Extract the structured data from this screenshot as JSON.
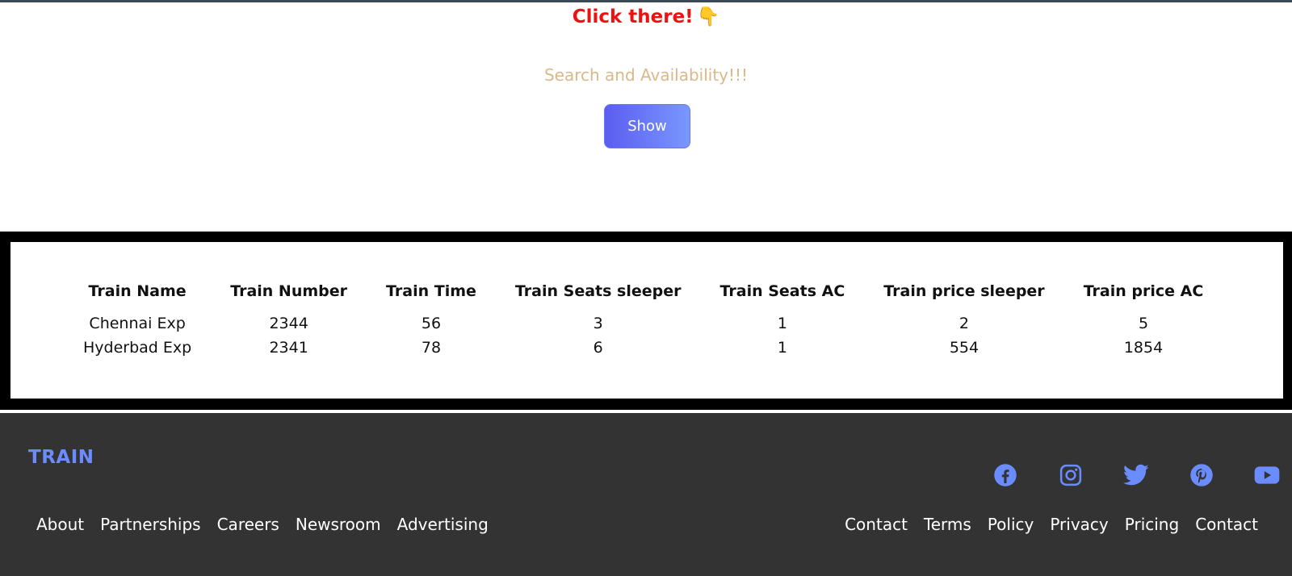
{
  "hero": {
    "click_text": "Click there!",
    "click_emoji": "👇",
    "search_title": "Search and Availability!!!",
    "show_label": "Show"
  },
  "table": {
    "headers": [
      "Train Name",
      "Train Number",
      "Train Time",
      "Train Seats sleeper",
      "Train Seats AC",
      "Train price sleeper",
      "Train price AC"
    ],
    "rows": [
      [
        "Chennai Exp",
        "2344",
        "56",
        "3",
        "1",
        "2",
        "5"
      ],
      [
        "Hyderbad Exp",
        "2341",
        "78",
        "6",
        "1",
        "554",
        "1854"
      ]
    ]
  },
  "footer": {
    "brand": "TRAIN",
    "social_icons": [
      "facebook-icon",
      "instagram-icon",
      "twitter-icon",
      "pinterest-icon",
      "youtube-icon"
    ],
    "left_links": [
      "About",
      "Partnerships",
      "Careers",
      "Newsroom",
      "Advertising"
    ],
    "right_links": [
      "Contact",
      "Terms",
      "Policy",
      "Privacy",
      "Pricing",
      "Contact"
    ]
  },
  "colors": {
    "accent": "#6b8cff",
    "click_red": "#ee1111",
    "search_tan": "#d9b88a",
    "footer_bg": "#333333"
  }
}
